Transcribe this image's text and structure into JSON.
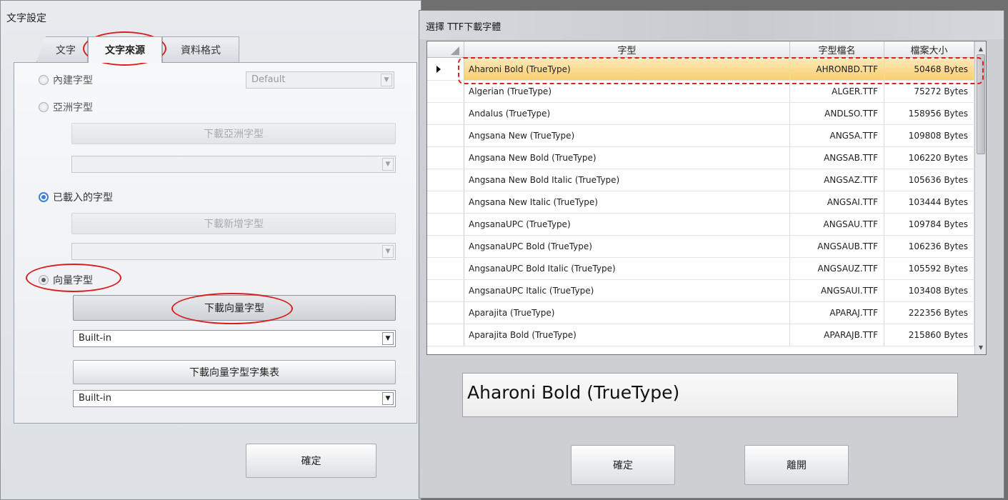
{
  "left": {
    "title": "文字設定",
    "tabs": [
      "文字",
      "文字來源",
      "資料格式"
    ],
    "builtin_font": {
      "label": "內建字型",
      "value": "Default"
    },
    "asian_font": {
      "label": "亞洲字型",
      "button": "下載亞洲字型"
    },
    "loaded_font": {
      "label": "已載入的字型",
      "button": "下載新增字型"
    },
    "vector_font": {
      "label": "向量字型",
      "button": "下載向量字型",
      "combo_value": "Built-in",
      "charset_button": "下載向量字型字集表",
      "charset_value": "Built-in"
    },
    "ok_button": "確定"
  },
  "right": {
    "title": "選擇 TTF下載字體",
    "columns": [
      "字型",
      "字型檔名",
      "檔案大小"
    ],
    "rows": [
      {
        "name": "Aharoni Bold (TrueType)",
        "file": "AHRONBD.TTF",
        "size": "50468 Bytes"
      },
      {
        "name": "Algerian (TrueType)",
        "file": "ALGER.TTF",
        "size": "75272 Bytes"
      },
      {
        "name": "Andalus (TrueType)",
        "file": "ANDLSO.TTF",
        "size": "158956 Bytes"
      },
      {
        "name": "Angsana New (TrueType)",
        "file": "ANGSA.TTF",
        "size": "109808 Bytes"
      },
      {
        "name": "Angsana New Bold (TrueType)",
        "file": "ANGSAB.TTF",
        "size": "106220 Bytes"
      },
      {
        "name": "Angsana New Bold Italic (TrueType)",
        "file": "ANGSAZ.TTF",
        "size": "105636 Bytes"
      },
      {
        "name": "Angsana New Italic (TrueType)",
        "file": "ANGSAI.TTF",
        "size": "103444 Bytes"
      },
      {
        "name": "AngsanaUPC (TrueType)",
        "file": "ANGSAU.TTF",
        "size": "109784 Bytes"
      },
      {
        "name": "AngsanaUPC Bold (TrueType)",
        "file": "ANGSAUB.TTF",
        "size": "106236 Bytes"
      },
      {
        "name": "AngsanaUPC Bold Italic (TrueType)",
        "file": "ANGSAUZ.TTF",
        "size": "105592 Bytes"
      },
      {
        "name": "AngsanaUPC Italic (TrueType)",
        "file": "ANGSAUI.TTF",
        "size": "103408 Bytes"
      },
      {
        "name": "Aparajita (TrueType)",
        "file": "APARAJ.TTF",
        "size": "222356 Bytes"
      },
      {
        "name": "Aparajita Bold (TrueType)",
        "file": "APARAJB.TTF",
        "size": "215860 Bytes"
      }
    ],
    "selected_index": 0,
    "preview": "Aharoni Bold (TrueType)",
    "ok_button": "確定",
    "exit_button": "離開"
  },
  "colors": {
    "highlight": "#d81e1e",
    "selected_row": "#f9cf70",
    "radio_accent": "#3d7fd1"
  }
}
